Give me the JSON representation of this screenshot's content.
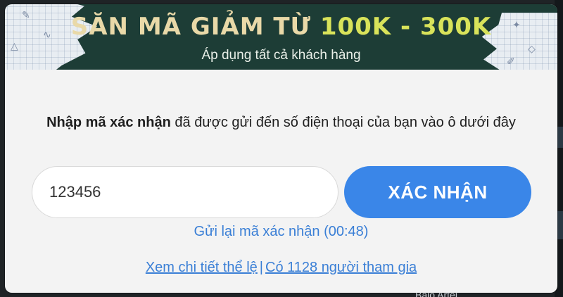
{
  "banner": {
    "title_main": "SĂN MÃ GIẢM TỪ ",
    "title_accent": "100K - 300K",
    "subtitle": "Áp dụng tất cả khách hàng"
  },
  "instruction": {
    "bold": "Nhập mã xác nhận",
    "rest": " đã được gửi đến số điện thoại của bạn vào ô dưới đây"
  },
  "code_input": {
    "value": "123456"
  },
  "confirm_button": {
    "label": "XÁC NHẬN"
  },
  "resend": {
    "label": "Gửi lại mã xác nhận (00:48)"
  },
  "footer": {
    "rules_link": "Xem chi tiết thể lệ",
    "separator": "|",
    "participants_link": "Có 1128 người tham gia"
  },
  "background": {
    "partial_text": "Balo Artel"
  },
  "colors": {
    "banner_bg": "#1d3d36",
    "title_main": "#e9d9a8",
    "title_accent": "#d9e35a",
    "button": "#3a86e8",
    "link": "#3a7fd6",
    "modal_bg": "#f3f3f3"
  }
}
